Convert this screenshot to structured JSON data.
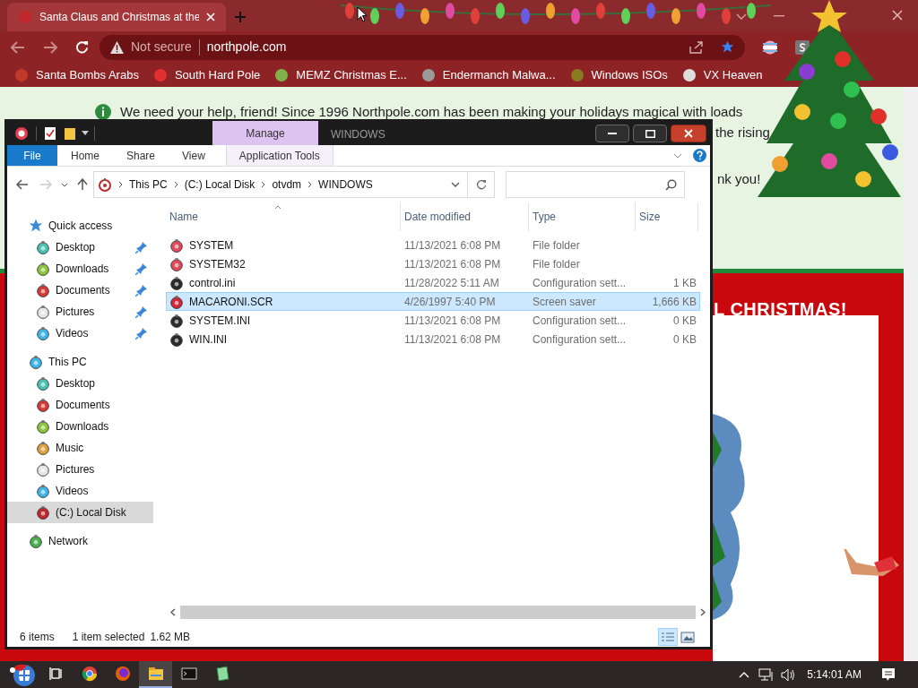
{
  "browser": {
    "tab": {
      "title": "Santa Claus and Christmas at the",
      "selected": true
    },
    "security": "Not secure",
    "address": "northpole.com",
    "bookmarks": [
      {
        "label": "Santa Bombs Arabs",
        "color": "#c0392b"
      },
      {
        "label": "South Hard Pole",
        "color": "#e03030"
      },
      {
        "label": "MEMZ Christmas E...",
        "color": "#7fb24a"
      },
      {
        "label": "Endermanch Malwa...",
        "color": "#9a9a9a"
      },
      {
        "label": "Windows ISOs",
        "color": "#8a7a20"
      },
      {
        "label": "VX Heaven",
        "color": "#dddddd"
      }
    ]
  },
  "page": {
    "notice": [
      "We need your help, friend! Since 1996 Northpole.com has been making your holidays magical with loads",
      "the rising",
      "nk you!"
    ],
    "banner_heading": "L CHRISTMAS!"
  },
  "explorer": {
    "title": "WINDOWS",
    "context_tab": "Manage",
    "ribbon_tabs": [
      {
        "label": "File",
        "kind": "file"
      },
      {
        "label": "Home",
        "kind": "plain"
      },
      {
        "label": "Share",
        "kind": "plain"
      },
      {
        "label": "View",
        "kind": "plain"
      },
      {
        "label": "Application Tools",
        "kind": "context"
      }
    ],
    "breadcrumb": [
      "This PC",
      "(C:) Local Disk",
      "otvdm",
      "WINDOWS"
    ],
    "nav": [
      {
        "label": "Quick access",
        "kind": "star",
        "selected": false,
        "children": [
          {
            "label": "Desktop",
            "color": "#4cc3b0",
            "pinned": true,
            "selected": false
          },
          {
            "label": "Downloads",
            "color": "#8cc63f",
            "pinned": true,
            "selected": false
          },
          {
            "label": "Documents",
            "color": "#d63a3a",
            "pinned": true,
            "selected": false
          },
          {
            "label": "Pictures",
            "color": "#e6e6e6",
            "pinned": true,
            "selected": false
          },
          {
            "label": "Videos",
            "color": "#3fb6e8",
            "pinned": true,
            "selected": false
          }
        ]
      },
      {
        "label": "This PC",
        "kind": "ornament",
        "color": "#3fb6e8",
        "selected": false,
        "children": [
          {
            "label": "Desktop",
            "color": "#4cc3b0",
            "pinned": false,
            "selected": false
          },
          {
            "label": "Documents",
            "color": "#d63a3a",
            "pinned": false,
            "selected": false
          },
          {
            "label": "Downloads",
            "color": "#8cc63f",
            "pinned": false,
            "selected": false
          },
          {
            "label": "Music",
            "color": "#e0a040",
            "pinned": false,
            "selected": false
          },
          {
            "label": "Pictures",
            "color": "#e6e6e6",
            "pinned": false,
            "selected": false
          },
          {
            "label": "Videos",
            "color": "#3fb6e8",
            "pinned": false,
            "selected": false
          },
          {
            "label": "(C:) Local Disk",
            "color": "#c0282d",
            "pinned": false,
            "selected": true
          }
        ]
      },
      {
        "label": "Network",
        "kind": "ornament",
        "color": "#4caf50",
        "selected": false
      }
    ],
    "columns": [
      "Name",
      "Date modified",
      "Type",
      "Size"
    ],
    "rows": [
      {
        "name": "SYSTEM",
        "date": "11/13/2021 6:08 PM",
        "type": "File folder",
        "size": "",
        "color": "#e04a5a",
        "selected": false
      },
      {
        "name": "SYSTEM32",
        "date": "11/13/2021 6:08 PM",
        "type": "File folder",
        "size": "",
        "color": "#e04a5a",
        "selected": false
      },
      {
        "name": "control.ini",
        "date": "11/28/2022 5:11 AM",
        "type": "Configuration sett...",
        "size": "1 KB",
        "color": "#2a2a2a",
        "selected": false
      },
      {
        "name": "MACARONI.SCR",
        "date": "4/26/1997 5:40 PM",
        "type": "Screen saver",
        "size": "1,666 KB",
        "color": "#d0283a",
        "selected": true
      },
      {
        "name": "SYSTEM.INI",
        "date": "11/13/2021 6:08 PM",
        "type": "Configuration sett...",
        "size": "0 KB",
        "color": "#2a2a2a",
        "selected": false
      },
      {
        "name": "WIN.INI",
        "date": "11/13/2021 6:08 PM",
        "type": "Configuration sett...",
        "size": "0 KB",
        "color": "#2a2a2a",
        "selected": false
      }
    ],
    "status": {
      "count": "6 items",
      "selection": "1 item selected",
      "size": "1.62 MB"
    },
    "view_modes": [
      {
        "kind": "details",
        "selected": true
      },
      {
        "kind": "thumbnails",
        "selected": false
      }
    ]
  },
  "taskbar": {
    "apps": [
      {
        "kind": "taskview",
        "selected": false
      },
      {
        "kind": "chrome",
        "selected": false
      },
      {
        "kind": "firefox",
        "selected": false
      },
      {
        "kind": "explorer",
        "selected": true
      },
      {
        "kind": "console",
        "selected": false
      },
      {
        "kind": "notepad",
        "selected": false
      }
    ],
    "clock": "5:14:01 AM"
  }
}
